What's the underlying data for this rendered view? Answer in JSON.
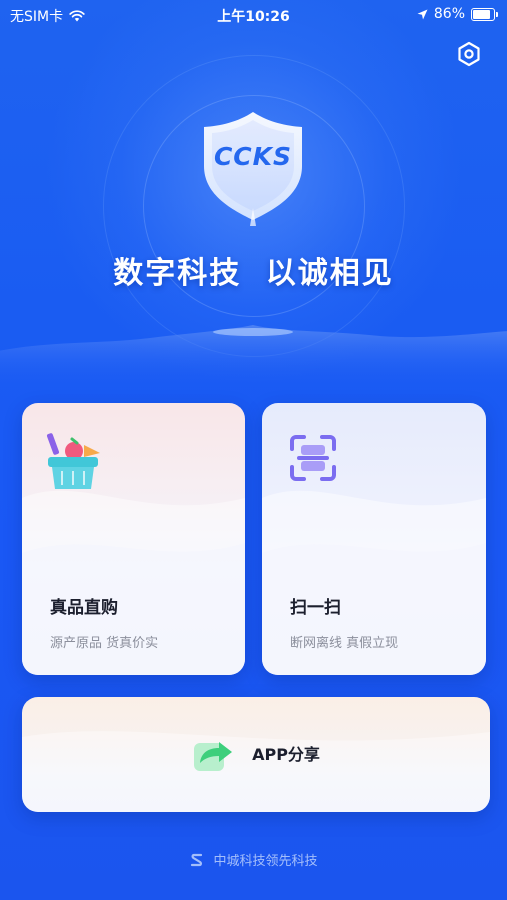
{
  "status_bar": {
    "carrier": "无SIM卡",
    "time": "上午10:26",
    "battery": "86%",
    "battery_level": 0.86
  },
  "header": {
    "logo_text": "CCKS",
    "slogan_part1": "数字科技",
    "slogan_part2": "以诚相见"
  },
  "cards": [
    {
      "title": "真品直购",
      "subtitle": "源产原品 货真价实",
      "icon": "shopping-basket-icon"
    },
    {
      "title": "扫一扫",
      "subtitle": "断网离线 真假立现",
      "icon": "scan-icon"
    }
  ],
  "share": {
    "label": "APP分享",
    "icon": "share-icon"
  },
  "footer": {
    "text": "中城科技领先科技"
  },
  "colors": {
    "background": "#1a5cf2",
    "scan_icon": "#7b6df0",
    "share_icon": "#3ecf7c"
  }
}
